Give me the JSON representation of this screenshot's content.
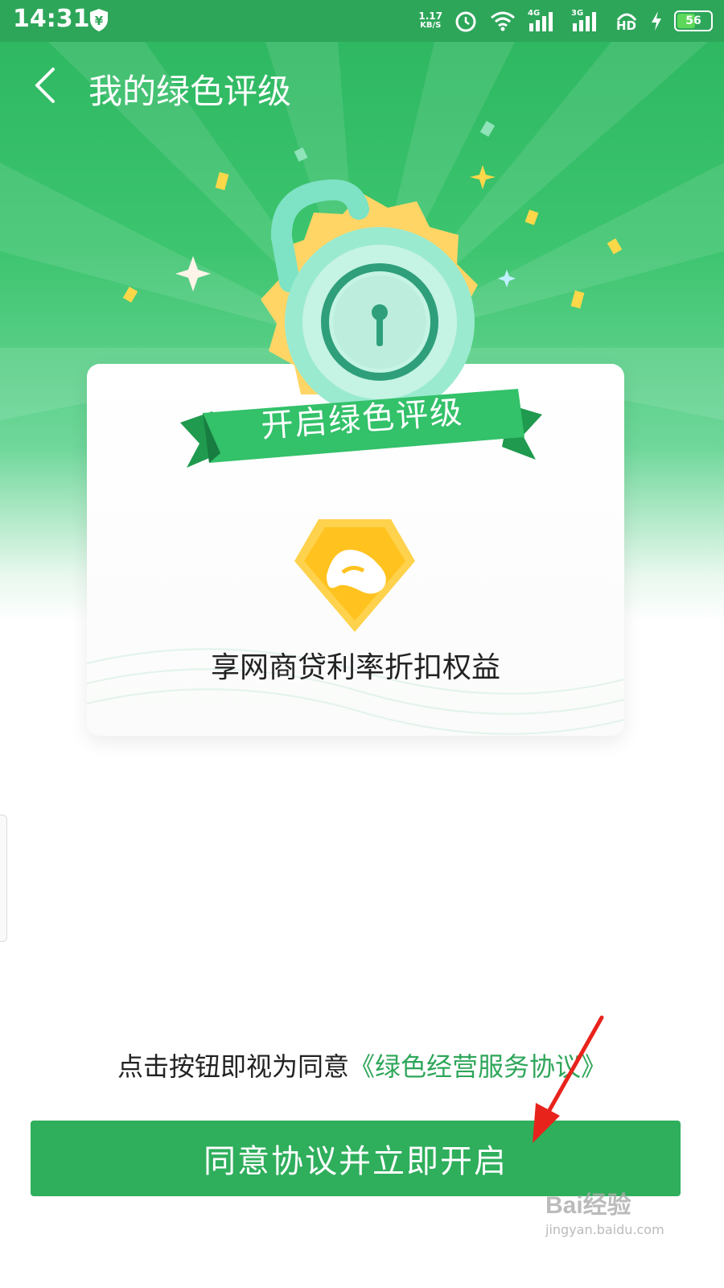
{
  "status_bar": {
    "time": "14:31",
    "net_speed_value": "1.17",
    "net_speed_unit": "KB/S",
    "signal_1_label": "4G",
    "signal_2_label": "3G",
    "hd_label": "HD",
    "battery_level": "56",
    "battery_percent": 56
  },
  "header": {
    "title": "我的绿色评级"
  },
  "hero": {
    "ribbon_text": "开启绿色评级",
    "benefit_text": "享网商贷利率折扣权益"
  },
  "agreement": {
    "prefix": "点击按钮即视为同意",
    "link_text": "《绿色经营服务协议》"
  },
  "primary_button": {
    "label": "同意协议并立即开启"
  },
  "watermark": {
    "brand": "Bai经验",
    "url": "jingyan.baidu.com"
  },
  "colors": {
    "brand_green": "#2fae5c",
    "link_green": "#2ea65a",
    "gold": "#ffd24d",
    "arrow_red": "#e8231c"
  }
}
